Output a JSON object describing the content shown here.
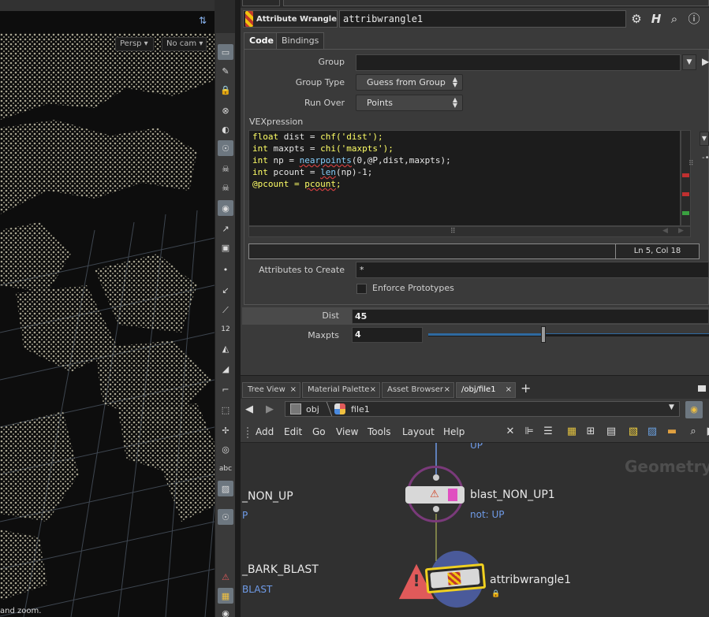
{
  "viewport": {
    "camera_button": "Persp",
    "cam_button": "No cam",
    "hint_text": "and zoom.",
    "tool_label_12": "12",
    "tool_label_abc": "abc"
  },
  "param_pane": {
    "node_type": "Attribute Wrangle",
    "node_name": "attribwrangle1",
    "tabs": [
      "Code",
      "Bindings"
    ],
    "group_label": "Group",
    "group_value": "",
    "group_type_label": "Group Type",
    "group_type_value": "Guess from Group",
    "run_over_label": "Run Over",
    "run_over_value": "Points",
    "vexpression_label": "VEXpression",
    "code": {
      "line1": [
        "float",
        " dist = ",
        "chf",
        "('dist');"
      ],
      "line2": [
        "int",
        " maxpts = ",
        "chi",
        "('maxpts');"
      ],
      "line3": [
        "int",
        " np = ",
        "nearpoints",
        "(0,@P,dist,maxpts);"
      ],
      "line4": [
        "int",
        " pcount = ",
        "len",
        "(np)-1;"
      ],
      "line5": [
        "@pcount = ",
        "pcount",
        ";"
      ]
    },
    "cursor_position": "Ln 5, Col 18",
    "attributes_to_create_label": "Attributes to Create",
    "attributes_to_create_value": "*",
    "enforce_prototypes_label": "Enforce Prototypes",
    "dist_label": "Dist",
    "dist_value": "45",
    "maxpts_label": "Maxpts",
    "maxpts_value": "4",
    "maxpts_slider_fraction": 0.41
  },
  "network_pane": {
    "tabs": [
      {
        "label": "Tree View"
      },
      {
        "label": "Material Palette"
      },
      {
        "label": "Asset Browser"
      },
      {
        "label": "/obj/file1"
      }
    ],
    "path": [
      "obj",
      "file1"
    ],
    "menus": [
      "Add",
      "Edit",
      "Go",
      "View",
      "Tools",
      "Layout",
      "Help"
    ],
    "watermark": "Geometry",
    "nodes": {
      "up_sub": "UP",
      "non_up_label": "_NON_UP",
      "non_up_sub": "P",
      "blast_non_up1_label": "blast_NON_UP1",
      "blast_non_up1_sub": "not: UP",
      "bark_blast_label": "_BARK_BLAST",
      "bark_blast_sub": "BLAST",
      "attribwrangle1_label": "attribwrangle1"
    }
  },
  "colors": {
    "accent_blue": "#6f9be8",
    "code_keyword": "#ffff66",
    "code_function": "#87cefa",
    "error_red": "#e05a5a",
    "node_ring": "#7a3a7a"
  }
}
